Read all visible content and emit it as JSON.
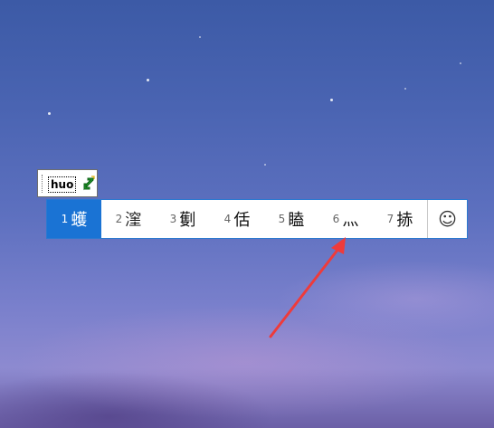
{
  "ime": {
    "composition": {
      "text": "huo",
      "icon": "ime-mode-arrow-icon"
    },
    "candidates": [
      {
        "num": "1",
        "char": "蠖",
        "selected": true
      },
      {
        "num": "2",
        "char": "漥",
        "selected": false
      },
      {
        "num": "3",
        "char": "劐",
        "selected": false
      },
      {
        "num": "4",
        "char": "佸",
        "selected": false
      },
      {
        "num": "5",
        "char": "瞌",
        "selected": false
      },
      {
        "num": "6",
        "char": "灬",
        "selected": false
      },
      {
        "num": "7",
        "char": "捇",
        "selected": false
      }
    ],
    "emoji_button": {
      "glyph": "☺",
      "icon": "smiley-icon"
    }
  },
  "colors": {
    "selection": "#1a73d4",
    "bar_border": "#2b79d0",
    "annotation_arrow": "#ee3b3b"
  }
}
